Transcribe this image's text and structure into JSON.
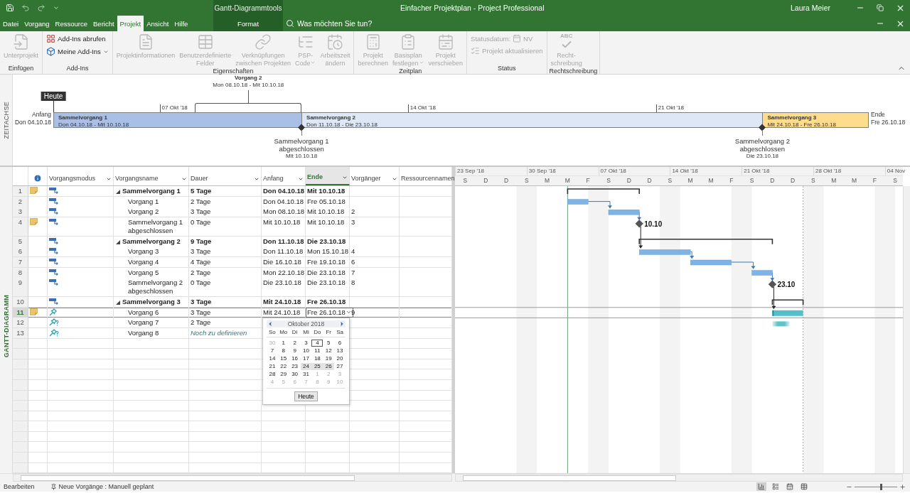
{
  "window": {
    "title": "Einfacher Projektplan  -  Project Professional",
    "user": "Laura Meier"
  },
  "ribbon_tabs": [
    {
      "label": "Datei",
      "selected": false
    },
    {
      "label": "Vorgang",
      "selected": false
    },
    {
      "label": "Ressource",
      "selected": false
    },
    {
      "label": "Bericht",
      "selected": false
    },
    {
      "label": "Projekt",
      "selected": true
    },
    {
      "label": "Ansicht",
      "selected": false
    },
    {
      "label": "Hilfe",
      "selected": false
    }
  ],
  "context_tabs": {
    "label": "Gantt-Diagrammtools",
    "tabs": [
      {
        "label": "Format",
        "selected": false
      }
    ]
  },
  "search": {
    "placeholder": "Was möchten Sie tun?"
  },
  "ribbon_groups": [
    {
      "label": "Einfügen",
      "items": [
        {
          "kind": "large",
          "label": "Unterprojekt",
          "disabled": true,
          "dropdown": false
        }
      ]
    },
    {
      "label": "Add-Ins",
      "items": [
        {
          "kind": "small",
          "label": "Add-Ins abrufen",
          "disabled": false,
          "dropdown": false
        },
        {
          "kind": "small",
          "label": "Meine Add-Ins",
          "disabled": false,
          "dropdown": true
        }
      ]
    },
    {
      "label": "Eigenschaften",
      "items": [
        {
          "kind": "large",
          "label": "Projektinformationen",
          "disabled": true,
          "dropdown": false
        },
        {
          "kind": "large",
          "label": "Benutzerdefinierte\nFelder",
          "disabled": true,
          "dropdown": false
        },
        {
          "kind": "large",
          "label": "Verknüpfungen\nzwischen Projekten",
          "disabled": true,
          "dropdown": false
        },
        {
          "kind": "large",
          "label": "PSP-\nCode",
          "disabled": true,
          "dropdown": true
        },
        {
          "kind": "large",
          "label": "Arbeitszeit\nändern",
          "disabled": true,
          "dropdown": false
        }
      ]
    },
    {
      "label": "Zeitplan",
      "items": [
        {
          "kind": "large",
          "label": "Projekt\nberechnen",
          "disabled": true,
          "dropdown": false
        },
        {
          "kind": "large",
          "label": "Basisplan\nfestlegen",
          "disabled": true,
          "dropdown": true
        },
        {
          "kind": "large",
          "label": "Projekt\nverschieben",
          "disabled": true,
          "dropdown": false
        }
      ]
    },
    {
      "label": "Status",
      "items": [
        {
          "kind": "field",
          "label": "Statusdatum:",
          "value": "NV",
          "disabled": true,
          "dropdown": false
        },
        {
          "kind": "small",
          "label": "Projekt aktualisieren",
          "disabled": true,
          "dropdown": false
        }
      ]
    },
    {
      "label": "Rechtschreibung",
      "items": [
        {
          "kind": "large",
          "label": "Recht-\nschreibung",
          "icon_text": "ABC",
          "disabled": true,
          "dropdown": false
        }
      ]
    }
  ],
  "timeline": {
    "label": "ZEITACHSE",
    "today": "Heute",
    "start_label": "Anfang",
    "start_date": "Don 04.10.18",
    "end_label": "Ende",
    "end_date": "Fre 26.10.18",
    "ticks": [
      "07 Okt '18",
      "14 Okt '18",
      "21 Okt '18"
    ],
    "bars": [
      {
        "name": "Sammelvorgang 1",
        "dates": "Don 04.10.18 - Mit 10.10.18",
        "color": "#aabfe6"
      },
      {
        "name": "Sammelvorgang 2",
        "dates": "Don 11.10.18 - Die 23.10.18",
        "color": "#dde7f5"
      },
      {
        "name": "Sammelvorgang 3",
        "dates": "Mit 24.10.18 - Fre 26.10.18",
        "color": "#fddc8e"
      }
    ],
    "callouts": [
      {
        "name": "Vorgang 2",
        "dates": "Mon 08.10.18 - Mit 10.10.18"
      }
    ],
    "milestones": [
      {
        "name": "Sammelvorgang 1\nabgeschlossen",
        "date": "Mit 10.10.18"
      },
      {
        "name": "Sammelvorgang 2\nabgeschlossen",
        "date": "Die 23.10.18"
      }
    ]
  },
  "view_label": "GANTT-DIAGRAMM",
  "columns": [
    {
      "label": "Vorgangsmodus",
      "selected": false
    },
    {
      "label": "Vorgangsname",
      "selected": false
    },
    {
      "label": "Dauer",
      "selected": false
    },
    {
      "label": "Anfang",
      "selected": false
    },
    {
      "label": "Ende",
      "selected": true
    },
    {
      "label": "Vorgänger",
      "selected": false
    },
    {
      "label": "Ressourcennamen",
      "selected": false
    }
  ],
  "tasks": [
    {
      "id": "1",
      "name": "Sammelvorgang 1",
      "kind": "summary",
      "manual": false,
      "scheduled": true,
      "note": true,
      "duration": "5 Tage",
      "duration_set": true,
      "start": "Don 04.10.18",
      "finish": "Mit 10.10.18",
      "selected": false,
      "editing": false,
      "expanded": true,
      "children": [
        {
          "id": "2",
          "name": "Vorgang 1",
          "kind": "task",
          "manual": false,
          "scheduled": true,
          "note": false,
          "duration": "2 Tage",
          "duration_set": true,
          "start": "Don 04.10.18",
          "finish": "Fre 05.10.18",
          "selected": false,
          "editing": false
        },
        {
          "id": "3",
          "name": "Vorgang 2",
          "kind": "task",
          "manual": false,
          "scheduled": true,
          "note": false,
          "duration": "3 Tage",
          "duration_set": true,
          "start": "Mon 08.10.18",
          "finish": "Mit 10.10.18",
          "predecessors": "2",
          "selected": false,
          "editing": false
        },
        {
          "id": "4",
          "name": "Sammelvorgang 1 abgeschlossen",
          "kind": "milestone",
          "manual": false,
          "scheduled": true,
          "note": true,
          "duration": "0 Tage",
          "duration_set": true,
          "start": "Mit 10.10.18",
          "finish": "Mit 10.10.18",
          "predecessors": "3",
          "selected": false,
          "editing": false,
          "gantt_label": "10.10"
        }
      ]
    },
    {
      "id": "5",
      "name": "Sammelvorgang 2",
      "kind": "summary",
      "manual": false,
      "scheduled": true,
      "note": false,
      "duration": "9 Tage",
      "duration_set": true,
      "start": "Don 11.10.18",
      "finish": "Die 23.10.18",
      "selected": false,
      "editing": false,
      "expanded": true,
      "children": [
        {
          "id": "6",
          "name": "Vorgang 3",
          "kind": "task",
          "manual": false,
          "scheduled": true,
          "note": false,
          "duration": "3 Tage",
          "duration_set": true,
          "start": "Don 11.10.18",
          "finish": "Mon 15.10.18",
          "predecessors": "4",
          "selected": false,
          "editing": false
        },
        {
          "id": "7",
          "name": "Vorgang 4",
          "kind": "task",
          "manual": false,
          "scheduled": true,
          "note": false,
          "duration": "4 Tage",
          "duration_set": true,
          "start": "Die 16.10.18",
          "finish": "Fre 19.10.18",
          "predecessors": "6",
          "selected": false,
          "editing": false
        },
        {
          "id": "8",
          "name": "Vorgang 5",
          "kind": "task",
          "manual": false,
          "scheduled": true,
          "note": false,
          "duration": "2 Tage",
          "duration_set": true,
          "start": "Mon 22.10.18",
          "finish": "Die 23.10.18",
          "predecessors": "7",
          "selected": false,
          "editing": false
        },
        {
          "id": "9",
          "name": "Sammelvorgang 2 abgeschlossen",
          "kind": "milestone",
          "manual": false,
          "scheduled": true,
          "note": false,
          "duration": "0 Tage",
          "duration_set": true,
          "start": "Die 23.10.18",
          "finish": "Die 23.10.18",
          "predecessors": "8",
          "selected": false,
          "editing": false,
          "gantt_label": "23.10"
        }
      ]
    },
    {
      "id": "10",
      "name": "Sammelvorgang 3",
      "kind": "summary",
      "manual": false,
      "scheduled": true,
      "note": false,
      "duration": "3 Tage",
      "duration_set": true,
      "start": "Mit 24.10.18",
      "finish": "Fre 26.10.18",
      "selected": false,
      "editing": false,
      "expanded": true,
      "children": [
        {
          "id": "11",
          "name": "Vorgang 6",
          "kind": "task",
          "manual": true,
          "scheduled": true,
          "note": true,
          "duration": "3 Tage",
          "duration_set": true,
          "start": "Mit 24.10.18",
          "finish": "Fre 26.10.18",
          "predecessors": "9",
          "selected": true,
          "editing": true
        },
        {
          "id": "12",
          "name": "Vorgang 7",
          "kind": "task",
          "manual": true,
          "scheduled": false,
          "note": false,
          "duration": "2 Tage",
          "duration_set": true,
          "selected": false,
          "editing": false
        },
        {
          "id": "13",
          "name": "Vorgang 8",
          "kind": "task",
          "manual": true,
          "scheduled": false,
          "note": false,
          "duration": "Noch zu definieren",
          "duration_set": false,
          "selected": false,
          "editing": false
        }
      ]
    }
  ],
  "date_picker": {
    "month": "Oktober 2018",
    "weekdays": [
      "So",
      "Mo",
      "Di",
      "Mi",
      "Do",
      "Fr",
      "Sa"
    ],
    "today_button": "Heute",
    "days": [
      {
        "label": "30",
        "muted": true,
        "today": false,
        "selected": false
      },
      {
        "label": "1",
        "muted": false,
        "today": false,
        "selected": false
      },
      {
        "label": "2",
        "muted": false,
        "today": false,
        "selected": false
      },
      {
        "label": "3",
        "muted": false,
        "today": false,
        "selected": false
      },
      {
        "label": "4",
        "muted": false,
        "today": true,
        "selected": false
      },
      {
        "label": "5",
        "muted": false,
        "today": false,
        "selected": false
      },
      {
        "label": "6",
        "muted": false,
        "today": false,
        "selected": false
      },
      {
        "label": "7",
        "muted": false,
        "today": false,
        "selected": false
      },
      {
        "label": "8",
        "muted": false,
        "today": false,
        "selected": false
      },
      {
        "label": "9",
        "muted": false,
        "today": false,
        "selected": false
      },
      {
        "label": "10",
        "muted": false,
        "today": false,
        "selected": false
      },
      {
        "label": "11",
        "muted": false,
        "today": false,
        "selected": false
      },
      {
        "label": "12",
        "muted": false,
        "today": false,
        "selected": false
      },
      {
        "label": "13",
        "muted": false,
        "today": false,
        "selected": false
      },
      {
        "label": "14",
        "muted": false,
        "today": false,
        "selected": false
      },
      {
        "label": "15",
        "muted": false,
        "today": false,
        "selected": false
      },
      {
        "label": "16",
        "muted": false,
        "today": false,
        "selected": false
      },
      {
        "label": "17",
        "muted": false,
        "today": false,
        "selected": false
      },
      {
        "label": "18",
        "muted": false,
        "today": false,
        "selected": false
      },
      {
        "label": "19",
        "muted": false,
        "today": false,
        "selected": false
      },
      {
        "label": "20",
        "muted": false,
        "today": false,
        "selected": false
      },
      {
        "label": "21",
        "muted": false,
        "today": false,
        "selected": false
      },
      {
        "label": "22",
        "muted": false,
        "today": false,
        "selected": false
      },
      {
        "label": "23",
        "muted": false,
        "today": false,
        "selected": false
      },
      {
        "label": "24",
        "muted": false,
        "today": false,
        "selected": true
      },
      {
        "label": "25",
        "muted": false,
        "today": false,
        "selected": true
      },
      {
        "label": "26",
        "muted": false,
        "today": false,
        "selected": true
      },
      {
        "label": "27",
        "muted": false,
        "today": false,
        "selected": false
      },
      {
        "label": "28",
        "muted": false,
        "today": false,
        "selected": false
      },
      {
        "label": "29",
        "muted": false,
        "today": false,
        "selected": false
      },
      {
        "label": "30",
        "muted": false,
        "today": false,
        "selected": false
      },
      {
        "label": "31",
        "muted": false,
        "today": false,
        "selected": false
      },
      {
        "label": "1",
        "muted": true,
        "today": false,
        "selected": false
      },
      {
        "label": "2",
        "muted": true,
        "today": false,
        "selected": false
      },
      {
        "label": "3",
        "muted": true,
        "today": false,
        "selected": false
      },
      {
        "label": "4",
        "muted": true,
        "today": false,
        "selected": false
      },
      {
        "label": "5",
        "muted": true,
        "today": false,
        "selected": false
      },
      {
        "label": "6",
        "muted": true,
        "today": false,
        "selected": false
      },
      {
        "label": "7",
        "muted": true,
        "today": false,
        "selected": false
      },
      {
        "label": "8",
        "muted": true,
        "today": false,
        "selected": false
      },
      {
        "label": "9",
        "muted": true,
        "today": false,
        "selected": false
      },
      {
        "label": "10",
        "muted": true,
        "today": false,
        "selected": false
      }
    ]
  },
  "gantt_scale": {
    "weeks": [
      "23 Sep '18",
      "30 Sep '18",
      "07 Okt '18",
      "14 Okt '18",
      "21 Okt '18",
      "28 Okt '18",
      "04 Nov"
    ],
    "days": [
      "S",
      "D",
      "D",
      "S",
      "M",
      "M",
      "F",
      "S",
      "D",
      "D",
      "S",
      "M",
      "M",
      "F",
      "S",
      "D",
      "D",
      "S",
      "M",
      "M",
      "F",
      "S"
    ]
  },
  "status_bar": {
    "mode": "Bearbeiten",
    "new_tasks": "Neue Vorgänge : Manuell geplant",
    "views": [
      {
        "selected": true
      },
      {
        "selected": false
      },
      {
        "selected": false
      },
      {
        "selected": false
      }
    ],
    "zoom": {
      "level": 0.62
    }
  }
}
